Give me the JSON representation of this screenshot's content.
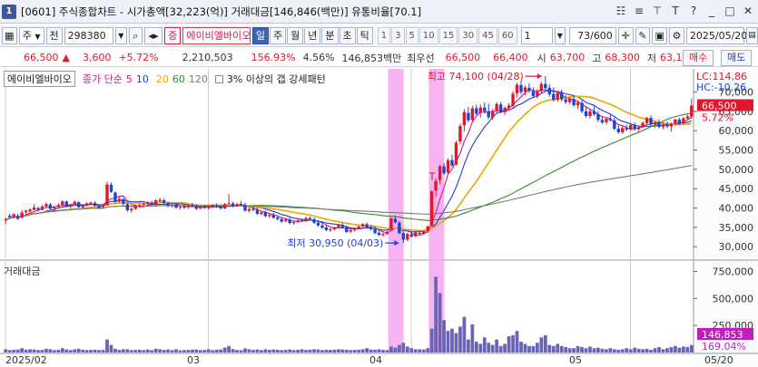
{
  "titlebar": {
    "window_number": "1",
    "title": "[0601] 주식종합차트 - 시가총액[32,223(억)] 거래대금[146,846(백만)] 유통비율[70.1]",
    "tool_icons": [
      "id-card-icon",
      "list-icon",
      "pin-icon",
      "text-icon",
      "help-icon",
      "minimize-icon",
      "maximize-icon",
      "close-icon"
    ],
    "tool_glyphs": [
      "☷",
      "≡",
      "⊤",
      "T",
      "?",
      "_",
      "□",
      "✕"
    ]
  },
  "toolbar": {
    "market": "주",
    "prev_label": "전",
    "code": "298380",
    "stock_badge": "증",
    "stock_name": "에이비엘바이오",
    "periods": [
      "일",
      "주",
      "월",
      "년",
      "분",
      "초",
      "틱"
    ],
    "active_period": "일",
    "intervals": [
      "1",
      "3",
      "5",
      "10",
      "15",
      "30",
      "45",
      "60"
    ],
    "custom_interval": "1",
    "page_counter": "73/600",
    "date": "2025/05/20"
  },
  "quote": {
    "price": "66,500",
    "arrow": "▲",
    "change": "3,600",
    "change_pct": "+5.72%",
    "volume": "2,210,503",
    "volume_ratio": "156.93%",
    "turnover": "4.56%",
    "amount": "146,853백만",
    "best_label": "최우선",
    "ask1": "66,500",
    "bid1": "66,400",
    "open_label": "시",
    "open": "63,700",
    "high_label": "고",
    "high": "68,300",
    "low_label": "저",
    "low": "63,100",
    "buy_label": "매수",
    "sell_label": "매도"
  },
  "legend": {
    "name": "에이비엘바이오",
    "ma_label": "종가 단순",
    "ma_periods": [
      "5",
      "10",
      "20",
      "60",
      "120"
    ],
    "pattern": "3% 이상의 갭 강세패턴"
  },
  "colors": {
    "up": "#e0182b",
    "down": "#1f43d3",
    "ma5": "#d6148a",
    "ma10": "#1f3fd0",
    "ma20": "#e8a800",
    "ma60": "#2e8b2e",
    "ma120": "#7a7a7a",
    "volume": "#6a64b4",
    "highlight": "#f3a6ee"
  },
  "chart_data": {
    "type": "candlestick",
    "x_labels": [
      "2025/02",
      "03",
      "04",
      "05",
      "05/20"
    ],
    "y_ticks": [
      "70,000",
      "65,000",
      "60,000",
      "55,000",
      "50,000",
      "45,000",
      "40,000",
      "35,000",
      "30,000"
    ],
    "volume_ticks": [
      "750,000",
      "500,000",
      "250,000"
    ],
    "volume_label": "거래대금",
    "limit_up": "LC:114,86",
    "limit_down": "HC:-10,26",
    "last_price_tag": "66,500",
    "last_pct_tag": "5.72%",
    "last_volume_tag": "146,853",
    "last_volume_pct": "169.04%",
    "high_annotation": "최고 74,100 (04/28)",
    "low_annotation": "최저 30,950 (04/03)",
    "gap_marker": "T",
    "highlight_days": [
      95,
      105
    ],
    "ohlc": [
      [
        37000,
        37600,
        35800,
        37000
      ],
      [
        38000,
        38500,
        37400,
        37600
      ],
      [
        37600,
        38600,
        37300,
        38400
      ],
      [
        38000,
        38500,
        36900,
        37200
      ],
      [
        37500,
        39500,
        37300,
        38800
      ],
      [
        38900,
        39600,
        38200,
        39300
      ],
      [
        39100,
        40000,
        38800,
        39600
      ],
      [
        39500,
        40900,
        39400,
        40100
      ],
      [
        40000,
        40400,
        39100,
        39600
      ],
      [
        39500,
        40700,
        39400,
        40400
      ],
      [
        40400,
        41500,
        40100,
        41000
      ],
      [
        40900,
        41300,
        39600,
        39800
      ],
      [
        39900,
        40600,
        38900,
        40300
      ],
      [
        40300,
        41200,
        40000,
        40800
      ],
      [
        40800,
        42000,
        40500,
        41700
      ],
      [
        41700,
        41900,
        40300,
        40500
      ],
      [
        40400,
        41100,
        39700,
        40900
      ],
      [
        40900,
        42000,
        40600,
        41600
      ],
      [
        41500,
        41700,
        40000,
        40200
      ],
      [
        40100,
        41000,
        39900,
        40700
      ],
      [
        40700,
        41500,
        40400,
        41200
      ],
      [
        41200,
        41700,
        40800,
        41400
      ],
      [
        41300,
        41800,
        40400,
        40600
      ],
      [
        40600,
        40900,
        39700,
        40100
      ],
      [
        40300,
        41000,
        39800,
        40800
      ],
      [
        40700,
        46800,
        40600,
        46100
      ],
      [
        46000,
        46600,
        43900,
        44200
      ],
      [
        44000,
        44300,
        41100,
        41700
      ],
      [
        41700,
        42800,
        41400,
        42400
      ],
      [
        42300,
        42600,
        40600,
        41100
      ],
      [
        41000,
        41400,
        39100,
        39400
      ],
      [
        39400,
        40200,
        38800,
        39800
      ],
      [
        39800,
        40900,
        39500,
        40500
      ],
      [
        40600,
        41200,
        40100,
        40800
      ],
      [
        40800,
        41400,
        40300,
        41100
      ],
      [
        41000,
        41800,
        40700,
        41500
      ],
      [
        41400,
        41900,
        40700,
        40900
      ],
      [
        41000,
        42300,
        40700,
        42000
      ],
      [
        41800,
        42600,
        41400,
        42100
      ],
      [
        42000,
        42500,
        41000,
        41300
      ],
      [
        41300,
        41600,
        40200,
        40600
      ],
      [
        40700,
        41200,
        40100,
        40900
      ],
      [
        40900,
        41300,
        39800,
        40100
      ],
      [
        40100,
        40700,
        39600,
        40300
      ],
      [
        40300,
        40900,
        39800,
        40200
      ],
      [
        40200,
        41000,
        39800,
        40700
      ],
      [
        40700,
        41300,
        40200,
        40600
      ],
      [
        40500,
        40900,
        39500,
        39800
      ],
      [
        39900,
        40600,
        39600,
        40400
      ],
      [
        40300,
        40800,
        39800,
        40000
      ],
      [
        40000,
        40700,
        39600,
        40400
      ],
      [
        40400,
        41000,
        40000,
        40800
      ],
      [
        40700,
        41200,
        40000,
        40300
      ],
      [
        40300,
        40800,
        39600,
        39900
      ],
      [
        39900,
        41300,
        39700,
        41000
      ],
      [
        41100,
        43600,
        40900,
        41200
      ],
      [
        41200,
        41600,
        40200,
        40600
      ],
      [
        40500,
        41300,
        40300,
        41000
      ],
      [
        41000,
        41800,
        40600,
        40800
      ],
      [
        40800,
        41400,
        39100,
        39300
      ],
      [
        39300,
        40200,
        38900,
        39700
      ],
      [
        39800,
        40400,
        39200,
        39500
      ],
      [
        39500,
        40000,
        38200,
        38500
      ],
      [
        38500,
        39300,
        38100,
        38900
      ],
      [
        38900,
        39300,
        37600,
        37900
      ],
      [
        37900,
        38600,
        37400,
        38200
      ],
      [
        38200,
        38800,
        37200,
        37500
      ],
      [
        37500,
        38100,
        36800,
        37100
      ],
      [
        37100,
        37700,
        36200,
        36500
      ],
      [
        36600,
        37300,
        36300,
        37000
      ],
      [
        37000,
        37500,
        35800,
        36100
      ],
      [
        36100,
        36800,
        35700,
        36400
      ],
      [
        36400,
        37200,
        36100,
        36800
      ],
      [
        36800,
        37300,
        36400,
        36700
      ],
      [
        36700,
        37700,
        36500,
        37400
      ],
      [
        37400,
        37800,
        36800,
        37100
      ],
      [
        37100,
        37600,
        35900,
        36200
      ],
      [
        36200,
        36900,
        35200,
        35500
      ],
      [
        35500,
        36300,
        34600,
        34900
      ],
      [
        35000,
        35600,
        34000,
        34300
      ],
      [
        34300,
        34900,
        33800,
        34500
      ],
      [
        34500,
        35200,
        34200,
        34900
      ],
      [
        35000,
        35900,
        34700,
        35500
      ],
      [
        35600,
        36100,
        34700,
        34900
      ],
      [
        35000,
        35400,
        33500,
        33800
      ],
      [
        33900,
        34600,
        33500,
        34300
      ],
      [
        34300,
        35000,
        33900,
        34700
      ],
      [
        34700,
        35500,
        34500,
        35200
      ],
      [
        35200,
        36100,
        35000,
        35800
      ],
      [
        35800,
        36300,
        34600,
        34900
      ],
      [
        35000,
        35600,
        34200,
        34500
      ],
      [
        34500,
        35200,
        33200,
        33500
      ],
      [
        33600,
        34100,
        32800,
        33000
      ],
      [
        33000,
        33600,
        32500,
        33300
      ],
      [
        33300,
        34100,
        33100,
        33800
      ],
      [
        34500,
        37600,
        34300,
        37300
      ],
      [
        37200,
        38000,
        36000,
        36300
      ],
      [
        36200,
        36600,
        33200,
        33500
      ],
      [
        33500,
        34000,
        30950,
        31800
      ],
      [
        31800,
        33600,
        31400,
        33300
      ],
      [
        33200,
        33800,
        32400,
        32600
      ],
      [
        32700,
        34000,
        32400,
        33700
      ],
      [
        33600,
        34200,
        33000,
        33300
      ],
      [
        33300,
        34300,
        33100,
        34000
      ],
      [
        34000,
        35500,
        33800,
        35200
      ],
      [
        35400,
        44600,
        35200,
        44300
      ],
      [
        44500,
        47600,
        43000,
        47000
      ],
      [
        47200,
        51200,
        46200,
        50800
      ],
      [
        50800,
        51600,
        48600,
        49000
      ],
      [
        49200,
        52800,
        48800,
        52400
      ],
      [
        52400,
        53800,
        50600,
        51000
      ],
      [
        51200,
        57400,
        51000,
        56900
      ],
      [
        57200,
        61800,
        56400,
        61200
      ],
      [
        61400,
        65600,
        59800,
        64800
      ],
      [
        64600,
        66200,
        62200,
        62700
      ],
      [
        62800,
        66400,
        62400,
        65800
      ],
      [
        65800,
        66700,
        64000,
        64400
      ],
      [
        64600,
        66800,
        63400,
        66000
      ],
      [
        66000,
        67300,
        64500,
        65000
      ],
      [
        65000,
        67000,
        63000,
        63500
      ],
      [
        63400,
        65600,
        62800,
        65100
      ],
      [
        65200,
        67400,
        64600,
        66900
      ],
      [
        66800,
        67500,
        64400,
        64800
      ],
      [
        64800,
        66300,
        64100,
        65900
      ],
      [
        65900,
        67100,
        65200,
        66500
      ],
      [
        66400,
        70300,
        66000,
        69600
      ],
      [
        69700,
        72400,
        68600,
        71900
      ],
      [
        71800,
        72900,
        69400,
        70000
      ],
      [
        70100,
        71700,
        69200,
        71200
      ],
      [
        71100,
        72300,
        69800,
        70300
      ],
      [
        70300,
        71200,
        68500,
        69000
      ],
      [
        69000,
        70700,
        68300,
        70200
      ],
      [
        70200,
        72700,
        69800,
        72100
      ],
      [
        72100,
        74100,
        70600,
        71000
      ],
      [
        71100,
        72000,
        68800,
        69400
      ],
      [
        69500,
        71200,
        67500,
        68000
      ],
      [
        68000,
        70300,
        67500,
        69800
      ],
      [
        69800,
        70600,
        67600,
        68100
      ],
      [
        68100,
        69200,
        66900,
        67400
      ],
      [
        67400,
        68600,
        66800,
        68200
      ],
      [
        68200,
        69000,
        66200,
        66600
      ],
      [
        66600,
        67800,
        65600,
        67300
      ],
      [
        67200,
        67900,
        64500,
        65000
      ],
      [
        65000,
        66300,
        63400,
        63800
      ],
      [
        63800,
        65500,
        63200,
        65000
      ],
      [
        65000,
        66300,
        63800,
        64300
      ],
      [
        64300,
        65100,
        62300,
        62800
      ],
      [
        62800,
        63800,
        61800,
        62100
      ],
      [
        62200,
        63500,
        61600,
        63100
      ],
      [
        63100,
        64300,
        62400,
        62700
      ],
      [
        62700,
        63400,
        60200,
        60500
      ],
      [
        60500,
        61600,
        59200,
        59600
      ],
      [
        59600,
        61100,
        59200,
        60700
      ],
      [
        60700,
        61500,
        59900,
        60300
      ],
      [
        60300,
        61900,
        60000,
        61500
      ],
      [
        61500,
        62200,
        60000,
        60400
      ],
      [
        60400,
        61300,
        59500,
        60900
      ],
      [
        60900,
        62400,
        60600,
        62000
      ],
      [
        62000,
        63600,
        61600,
        63300
      ],
      [
        63300,
        64000,
        61200,
        61700
      ],
      [
        61700,
        62500,
        60800,
        62200
      ],
      [
        62200,
        62900,
        60600,
        61000
      ],
      [
        61000,
        62200,
        60400,
        61600
      ],
      [
        61600,
        62400,
        60700,
        61100
      ],
      [
        61100,
        62200,
        59800,
        61800
      ],
      [
        61800,
        63100,
        61300,
        62900
      ],
      [
        62900,
        63400,
        61500,
        61900
      ],
      [
        61900,
        63600,
        61600,
        63200
      ],
      [
        63200,
        64200,
        62800,
        63700
      ],
      [
        63700,
        68300,
        63100,
        66500
      ]
    ],
    "volume": [
      30,
      22,
      25,
      28,
      40,
      26,
      30,
      28,
      22,
      24,
      35,
      30,
      22,
      25,
      40,
      28,
      22,
      30,
      35,
      25,
      22,
      24,
      26,
      22,
      24,
      120,
      70,
      35,
      24,
      30,
      30,
      22,
      24,
      26,
      22,
      28,
      22,
      35,
      30,
      24,
      28,
      22,
      30,
      20,
      22,
      24,
      26,
      28,
      22,
      24,
      30,
      22,
      26,
      28,
      45,
      60,
      32,
      24,
      22,
      38,
      30,
      24,
      28,
      22,
      30,
      24,
      28,
      25,
      22,
      24,
      28,
      22,
      25,
      30,
      24,
      26,
      30,
      28,
      22,
      26,
      24,
      26,
      30,
      28,
      26,
      22,
      24,
      26,
      30,
      40,
      28,
      26,
      30,
      24,
      22,
      55,
      45,
      70,
      90,
      55,
      40,
      30,
      30,
      28,
      40,
      220,
      700,
      550,
      300,
      200,
      220,
      180,
      240,
      330,
      120,
      260,
      100,
      80,
      140,
      90,
      70,
      120,
      60,
      80,
      150,
      160,
      200,
      100,
      80,
      60,
      60,
      90,
      140,
      160,
      70,
      60,
      80,
      60,
      50,
      40,
      40,
      60,
      50,
      40,
      55,
      40,
      45,
      35,
      30,
      40,
      30,
      25,
      30,
      40,
      30,
      45,
      35,
      30,
      35,
      25,
      40,
      50,
      30,
      40,
      50,
      60,
      45,
      55,
      50,
      69
    ]
  }
}
